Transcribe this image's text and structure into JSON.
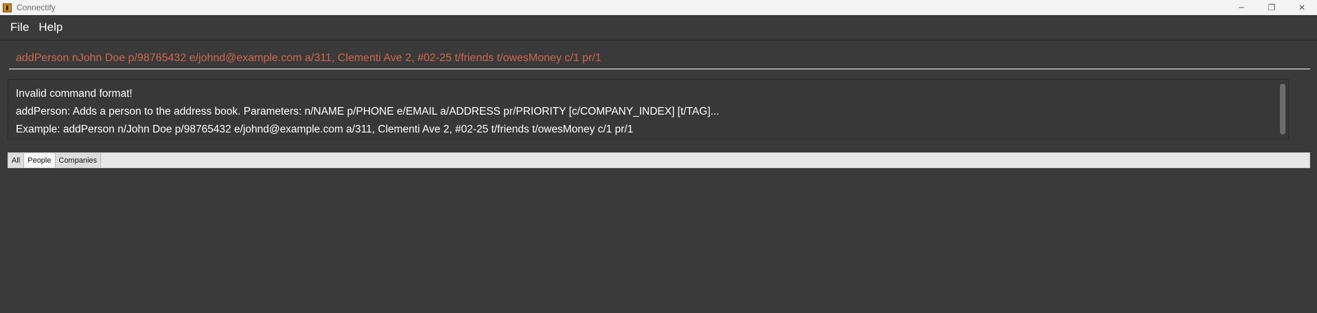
{
  "window": {
    "title": "Connectify",
    "controls": {
      "minimize": "─",
      "maximize": "❐",
      "close": "✕"
    }
  },
  "menu": {
    "items": [
      "File",
      "Help"
    ]
  },
  "command": {
    "value": "addPerson nJohn Doe p/98765432 e/johnd@example.com a/311, Clementi Ave 2, #02-25 t/friends t/owesMoney c/1 pr/1",
    "text_color": "#d06651"
  },
  "result": {
    "lines": [
      "Invalid command format!",
      "addPerson: Adds a person to the address book. Parameters: n/NAME p/PHONE e/EMAIL a/ADDRESS pr/PRIORITY [c/COMPANY_INDEX] [t/TAG]...",
      "Example: addPerson n/John Doe p/98765432 e/johnd@example.com a/311, Clementi Ave 2, #02-25 t/friends t/owesMoney c/1 pr/1"
    ]
  },
  "tabs": {
    "items": [
      "All",
      "People",
      "Companies"
    ],
    "selected": "People"
  },
  "colors": {
    "background": "#3a3a3a",
    "error_text": "#d06651",
    "text": "#ffffff"
  }
}
